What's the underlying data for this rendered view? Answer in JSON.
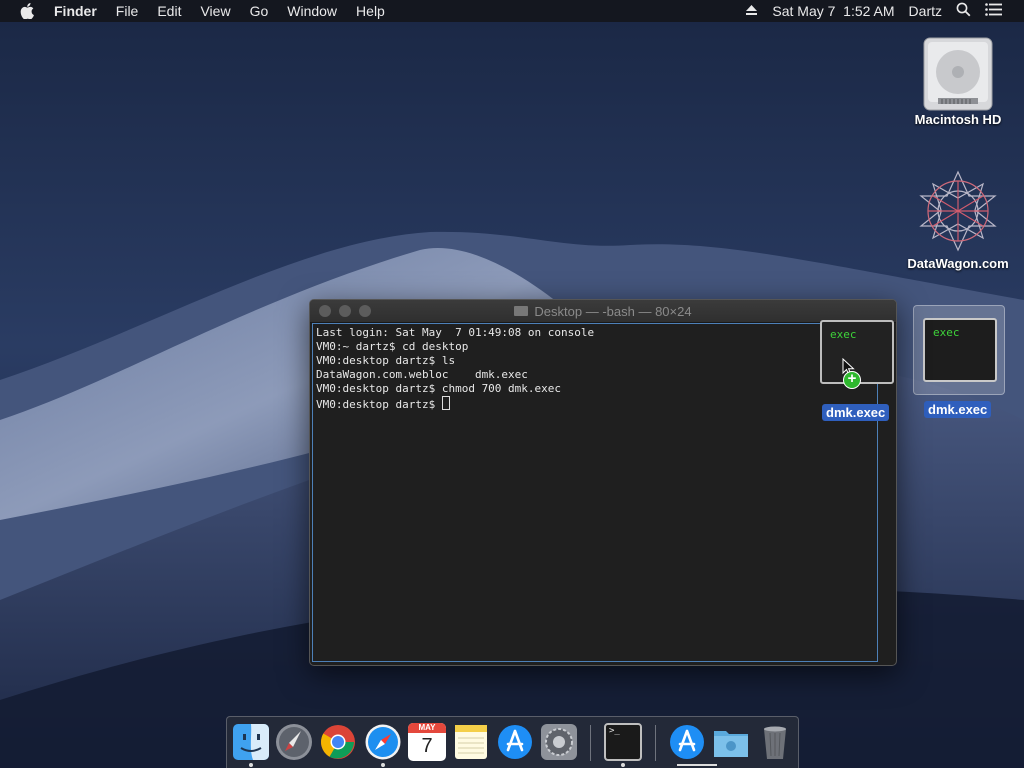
{
  "menubar": {
    "app_name": "Finder",
    "menus": [
      "File",
      "Edit",
      "View",
      "Go",
      "Window",
      "Help"
    ],
    "datetime": "Sat May 7  1:52 AM",
    "user": "Dartz",
    "icons": [
      "apple-icon",
      "eject-icon",
      "spotlight-icon",
      "notification-center-icon"
    ]
  },
  "desktop": {
    "icons": [
      {
        "label": "Macintosh HD",
        "icon": "hard-drive-icon"
      },
      {
        "label": "DataWagon.com",
        "icon": "webloc-icon"
      },
      {
        "label": "dmk.exec",
        "icon": "exec-file-icon",
        "thumb_text": "exec"
      }
    ]
  },
  "terminal": {
    "title": "Desktop — -bash — 80×24",
    "lines": [
      "Last login: Sat May  7 01:49:08 on console",
      "VM0:~ dartz$ cd desktop",
      "VM0:desktop dartz$ ls",
      "DataWagon.com.webloc    dmk.exec",
      "VM0:desktop dartz$ chmod 700 dmk.exec",
      "VM0:desktop dartz$ "
    ]
  },
  "drag": {
    "label": "dmk.exec",
    "thumb_text": "exec",
    "badge": "+"
  },
  "dock": {
    "items": [
      "finder-icon",
      "launchpad-icon",
      "chrome-icon",
      "safari-icon",
      "calendar-icon",
      "notes-icon",
      "app-store-icon",
      "system-preferences-icon",
      "terminal-icon",
      "app-store-icon",
      "downloads-folder-icon",
      "trash-icon"
    ],
    "calendar_month": "MAY",
    "calendar_day": "7",
    "terminal_glyph": ">_"
  },
  "colors": {
    "selection": "#2f5fbd",
    "exec_text": "#3ed33a",
    "terminal_border": "#4d80b8"
  }
}
